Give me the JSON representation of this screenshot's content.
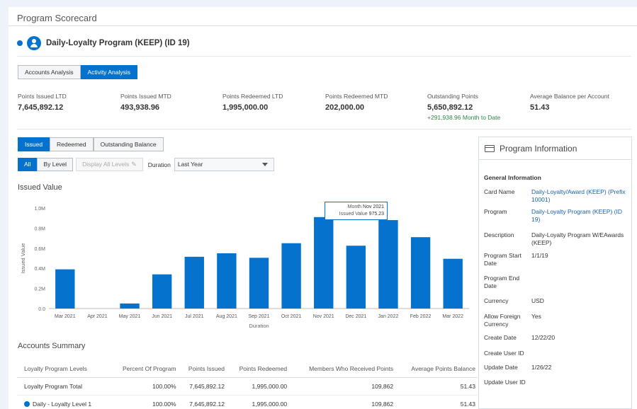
{
  "page": {
    "title": "Program Scorecard"
  },
  "program": {
    "name": "Daily-Loyalty Program (KEEP) (ID 19)"
  },
  "main_tabs": [
    "Accounts Analysis",
    "Activity Analysis"
  ],
  "metrics": [
    {
      "label": "Points Issued LTD",
      "value": "7,645,892.12",
      "delta": ""
    },
    {
      "label": "Points Issued MTD",
      "value": "493,938.96",
      "delta": ""
    },
    {
      "label": "Points Redeemed LTD",
      "value": "1,995,000.00",
      "delta": ""
    },
    {
      "label": "Points Redeemed MTD",
      "value": "202,000.00",
      "delta": ""
    },
    {
      "label": "Outstanding Points",
      "value": "5,650,892.12",
      "delta": "+291,938.96 Month to Date"
    },
    {
      "label": "Average Balance per Account",
      "value": "51.43",
      "delta": ""
    }
  ],
  "sub_tabs": [
    "Issued",
    "Redeemed",
    "Outstanding Balance"
  ],
  "filters": {
    "all": "All",
    "by_level": "By Level",
    "display_all_levels": "Display All Levels",
    "duration_label": "Duration",
    "duration_value": "Last Year"
  },
  "chart_section_title": "Issued Value",
  "chart_data": {
    "type": "bar",
    "categories": [
      "Mar 2021",
      "Apr 2021",
      "May 2021",
      "Jun 2021",
      "Jul 2021",
      "Aug 2021",
      "Sep 2021",
      "Oct 2021",
      "Nov 2021",
      "Dec 2021",
      "Jan 2022",
      "Feb 2022",
      "Mar 2022"
    ],
    "values": [
      390000,
      0,
      50000,
      340000,
      515000,
      550000,
      505000,
      650000,
      910000,
      625000,
      880000,
      710000,
      495000
    ],
    "ylabel": "Issued Value",
    "xlabel": "Duration",
    "ylim": [
      0,
      1000000
    ],
    "yticks": [
      "0.0",
      "0.2M",
      "0.4M",
      "0.6M",
      "0.8M",
      "1.0M"
    ],
    "grid": false,
    "color": "#0572ce",
    "tooltip": {
      "month_label": "Month",
      "month_value": "Nov 2021",
      "value_label": "Issued Value",
      "value_value": "975.23"
    }
  },
  "accounts_summary": {
    "title": "Accounts Summary",
    "columns": [
      "Loyalty Program Levels",
      "Percent Of Program",
      "Points Issued",
      "Points Redeemed",
      "Members Who Received Points",
      "Average Points Balance"
    ],
    "rows": [
      [
        "Loyalty Program Total",
        "100.00%",
        "7,645,892.12",
        "1,995,000.00",
        "109,862",
        "51.43"
      ],
      [
        "Daily - Loyalty Level 1",
        "100.00%",
        "7,645,892.12",
        "1,995,000.00",
        "109,862",
        "51.43"
      ]
    ]
  },
  "program_info": {
    "title": "Program Information",
    "section": "General Information",
    "fields": [
      {
        "label": "Card Name",
        "value": "Daily-Loyalty/Award (KEEP) (Prefix 10001)",
        "link": true
      },
      {
        "label": "Program",
        "value": "Daily-Loyalty Program (KEEP) (ID 19)",
        "link": true
      },
      {
        "label": "Description",
        "value": "Daily-Loyalty Program W/EAwards (KEEP)",
        "link": false
      },
      {
        "label": "Program Start Date",
        "value": "1/1/19",
        "link": false
      },
      {
        "label": "Program End Date",
        "value": "",
        "link": false
      },
      {
        "label": "Currency",
        "value": "USD",
        "link": false
      },
      {
        "label": "Allow Foreign Currency",
        "value": "Yes",
        "link": false
      },
      {
        "label": "Create Date",
        "value": "12/22/20",
        "link": false
      },
      {
        "label": "Create User ID",
        "value": "",
        "link": false
      },
      {
        "label": "Update Date",
        "value": "1/26/22",
        "link": false
      },
      {
        "label": "Update User ID",
        "value": "",
        "link": false
      }
    ]
  }
}
